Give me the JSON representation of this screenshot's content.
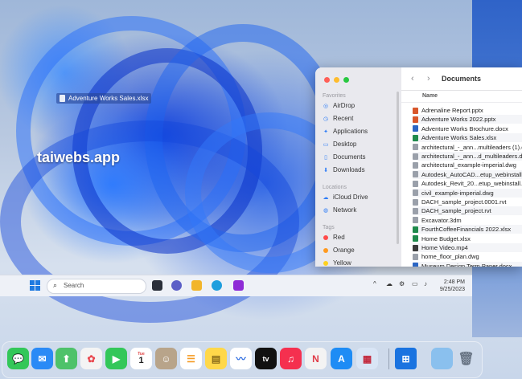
{
  "desktop": {
    "file_label": "Adventure Works Sales.xlsx",
    "watermark": "taiwebs.app"
  },
  "finder": {
    "title": "Documents",
    "column_name": "Name",
    "sidebar": {
      "favorites_header": "Favorites",
      "favorites": [
        {
          "label": "AirDrop",
          "icon": "airdrop-icon"
        },
        {
          "label": "Recent",
          "icon": "clock-icon"
        },
        {
          "label": "Applications",
          "icon": "applications-icon"
        },
        {
          "label": "Desktop",
          "icon": "desktop-icon"
        },
        {
          "label": "Documents",
          "icon": "document-icon"
        },
        {
          "label": "Downloads",
          "icon": "download-icon"
        }
      ],
      "locations_header": "Locations",
      "locations": [
        {
          "label": "iCloud Drive",
          "icon": "cloud-icon"
        },
        {
          "label": "Network",
          "icon": "network-icon"
        }
      ],
      "tags_header": "Tags",
      "tags": [
        {
          "label": "Red",
          "color": "#ff4b4b"
        },
        {
          "label": "Orange",
          "color": "#ff9a1f"
        },
        {
          "label": "Yellow",
          "color": "#ffd21f"
        }
      ]
    },
    "files": [
      {
        "name": "Adrenaline Report.pptx",
        "color": "#d8562b"
      },
      {
        "name": "Adventure Works 2022.pptx",
        "color": "#d8562b"
      },
      {
        "name": "Adventure Works Brochure.docx",
        "color": "#2b66c4"
      },
      {
        "name": "Adventure Works Sales.xlsx",
        "color": "#1f8a4c"
      },
      {
        "name": "architectural_-_ann...multileaders (1).dwg",
        "color": "#9aa0aa"
      },
      {
        "name": "architectural_-_ann...d_multileaders.dwg",
        "color": "#9aa0aa"
      },
      {
        "name": "architectural_example-imperial.dwg",
        "color": "#9aa0aa"
      },
      {
        "name": "Autodesk_AutoCAD...etup_webinstall.exe",
        "color": "#9aa0aa"
      },
      {
        "name": "Autodesk_Revit_20...etup_webinstall.exe",
        "color": "#9aa0aa"
      },
      {
        "name": "civil_example-imperial.dwg",
        "color": "#9aa0aa"
      },
      {
        "name": "DACH_sample_project.0001.rvt",
        "color": "#9aa0aa"
      },
      {
        "name": "DACH_sample_project.rvt",
        "color": "#9aa0aa"
      },
      {
        "name": "Excavator.3dm",
        "color": "#9aa0aa"
      },
      {
        "name": "FourthCoffeeFinancials 2022.xlsx",
        "color": "#1f8a4c"
      },
      {
        "name": "Home Budget.xlsx",
        "color": "#1f8a4c"
      },
      {
        "name": "Home Video.mp4",
        "color": "#3a3a3a"
      },
      {
        "name": "home_floor_plan.dwg",
        "color": "#9aa0aa"
      },
      {
        "name": "Museum Design Term Paper.docx",
        "color": "#2b66c4"
      }
    ]
  },
  "taskbar": {
    "search_placeholder": "Search",
    "time": "2:48 PM",
    "date": "9/25/2023"
  },
  "dock": {
    "calendar_month": "Tue",
    "calendar_day": "1",
    "tv_label": "tv"
  }
}
